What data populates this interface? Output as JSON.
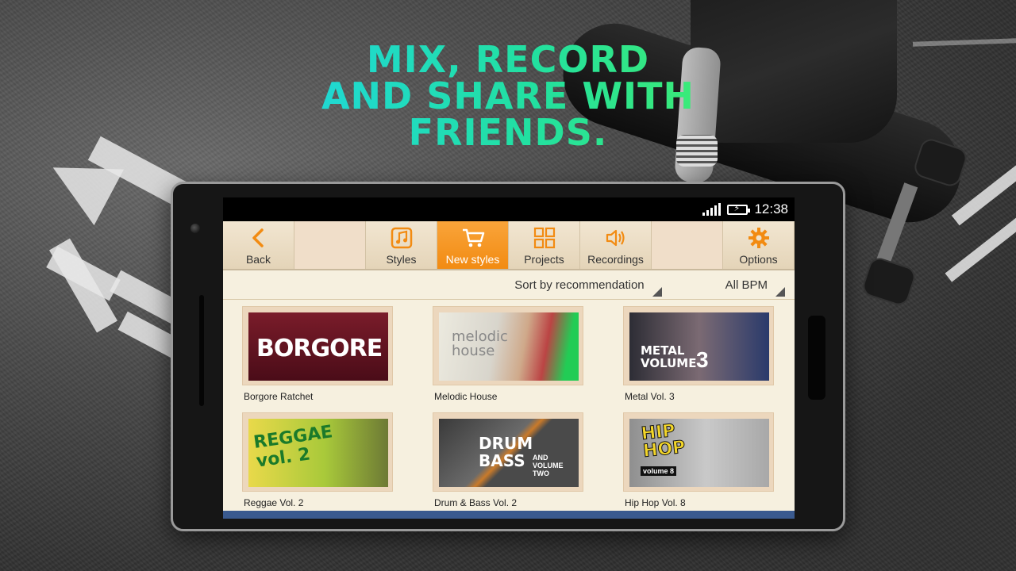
{
  "headline": {
    "line1": "MIX, RECORD",
    "line2": "AND SHARE WITH",
    "line3": "FRIENDS."
  },
  "status_bar": {
    "time": "12:38"
  },
  "toolbar": {
    "back": "Back",
    "styles": "Styles",
    "new_styles": "New styles",
    "projects": "Projects",
    "recordings": "Recordings",
    "options": "Options"
  },
  "sortbar": {
    "sort": "Sort by recommendation",
    "bpm": "All BPM"
  },
  "items": [
    {
      "title": "Borgore Ratchet",
      "art": "BORGORE"
    },
    {
      "title": "Melodic House",
      "art": "melodic house"
    },
    {
      "title": "Metal Vol. 3",
      "art": "METAL VOLUME",
      "art_number": "3"
    },
    {
      "title": "Reggae Vol. 2",
      "art": "REGGAE vol. 2"
    },
    {
      "title": "Drum & Bass Vol. 2",
      "art": "DRUM BASS",
      "art_sub": "AND VOLUME TWO"
    },
    {
      "title": "Hip Hop Vol. 8",
      "art": "HIP HOP",
      "art_sub": "volume 8"
    }
  ],
  "colors": {
    "accent": "#f28b12",
    "headline_start": "#1fd6e0",
    "headline_end": "#43ee6a",
    "screen_bg": "#f6f0df"
  }
}
